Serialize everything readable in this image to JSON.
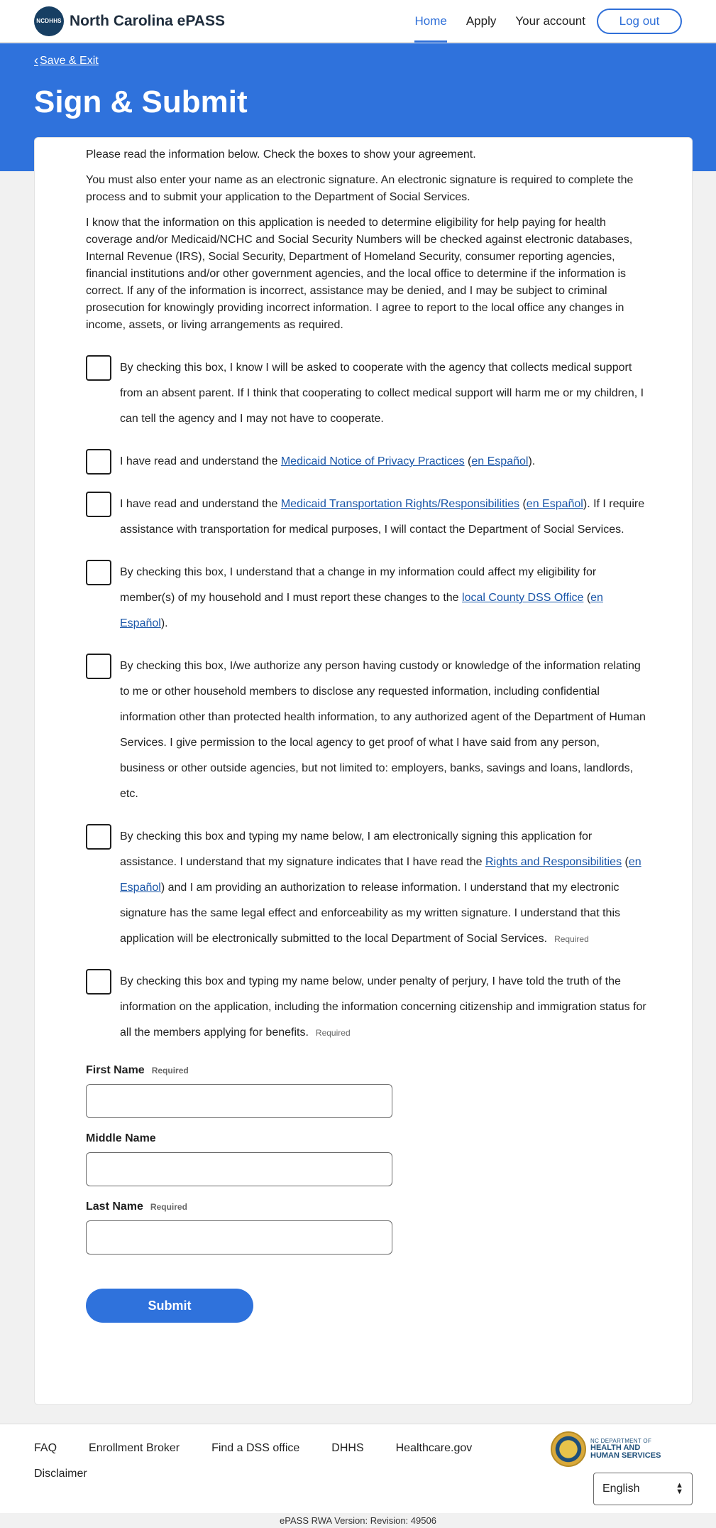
{
  "header": {
    "logo_text": "NCDHHS",
    "brand": "North Carolina ePASS",
    "nav": [
      "Home",
      "Apply",
      "Your account"
    ],
    "logout": "Log out"
  },
  "hero": {
    "save_exit": "Save & Exit",
    "title": "Sign & Submit"
  },
  "intro": [
    "Please read the information below. Check the boxes to show your agreement.",
    "You must also enter your name as an electronic signature. An electronic signature is required to complete the process and to submit your application to the Department of Social Services.",
    "I know that the information on this application is needed to determine eligibility for help paying for health coverage and/or Medicaid/NCHC and Social Security Numbers will be checked against electronic databases, Internal Revenue (IRS), Social Security, Department of Homeland Security, consumer reporting agencies, financial institutions and/or other government agencies, and the local office to determine if the information is correct. If any of the information is incorrect, assistance may be denied, and I may be subject to criminal prosecution for knowingly providing incorrect information. I agree to report to the local office any changes in income, assets, or living arrangements as required."
  ],
  "agreements": {
    "a1": "By checking this box, I know I will be asked to cooperate with the agency that collects medical support from an absent parent. If I think that cooperating to collect medical support will harm me or my children, I can tell the agency and I may not have to cooperate.",
    "a2_pre": "I have read and understand the ",
    "a2_link": "Medicaid Notice of Privacy Practices",
    "a2_mid": " (",
    "a2_es": "en Español",
    "a2_post": ").",
    "a3_pre": "I have read and understand the ",
    "a3_link": "Medicaid Transportation Rights/Responsibilities",
    "a3_mid": " (",
    "a3_es": "en Español",
    "a3_post": "). If I require assistance with transportation for medical purposes, I will contact the Department of Social Services.",
    "a4_pre": "By checking this box, I understand that a change in my information could affect my eligibility for member(s) of my household and I must report these changes to the ",
    "a4_link": "local County DSS Office",
    "a4_mid": " (",
    "a4_es": "en Español",
    "a4_post": ").",
    "a5": "By checking this box, I/we authorize any person having custody or knowledge of the information relating to me or other household members to disclose any requested information, including confidential information other than protected health information, to any authorized agent of the Department of Human Services. I give permission to the local agency to get proof of what I have said from any person, business or other outside agencies, but not limited to: employers, banks, savings and loans, landlords, etc.",
    "a6_pre": "By checking this box and typing my name below, I am electronically signing this application for assistance. I understand that my signature indicates that I have read the ",
    "a6_link": "Rights and Responsibilities",
    "a6_mid": " (",
    "a6_es": "en Español",
    "a6_post": ") and I am providing an authorization to release information. I understand that my electronic signature has the same legal effect and enforceability as my written signature. I understand that this application will be electronically submitted to the local Department of Social Services.",
    "a7": "By checking this box and typing my name below, under penalty of perjury, I have told the truth of the information on the application, including the information concerning citizenship and immigration status for all the members applying for benefits.",
    "required": "Required"
  },
  "form": {
    "first_name": "First Name",
    "middle_name": "Middle Name",
    "last_name": "Last Name",
    "required": "Required",
    "first_value": "",
    "middle_value": "",
    "last_value": "",
    "submit": "Submit"
  },
  "footer": {
    "links": [
      "FAQ",
      "Enrollment Broker",
      "Find a DSS office",
      "DHHS",
      "Healthcare.gov",
      "Disclaimer"
    ],
    "logo_small": "NC DEPARTMENT OF",
    "logo_big1": "HEALTH AND",
    "logo_big2": "HUMAN SERVICES",
    "language": "English",
    "version": "ePASS RWA Version: Revision: 49506"
  },
  "colors": {
    "accent": "#2f72dc",
    "link": "#1a56a8",
    "brand_dark": "#173f63"
  }
}
